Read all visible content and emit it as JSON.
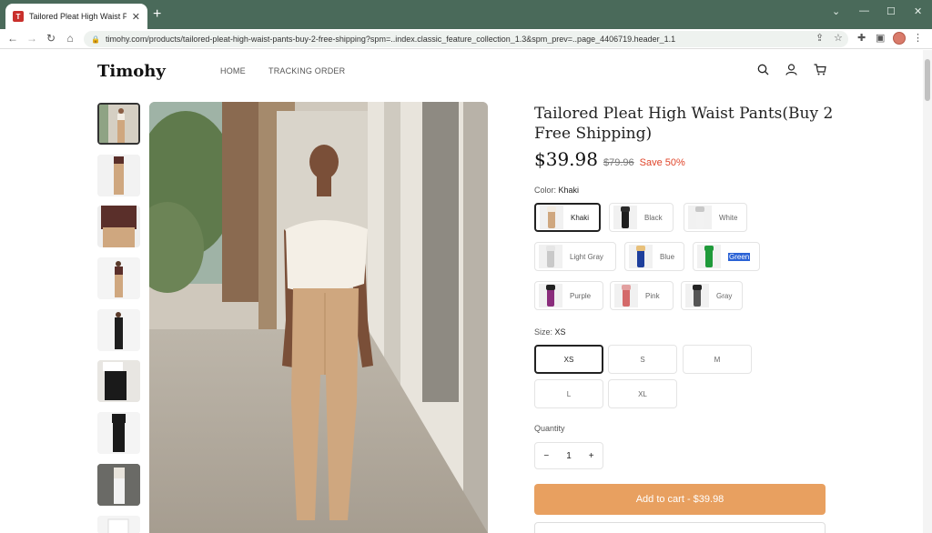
{
  "browser": {
    "tab_title": "Tailored Pleat High Waist Pants(B",
    "url": "timohy.com/products/tailored-pleat-high-waist-pants-buy-2-free-shipping?spm=..index.classic_feature_collection_1.3&spm_prev=..page_4406719.header_1.1",
    "colors": {
      "frame": "#4a6a5a",
      "accent": "#e8a060"
    }
  },
  "site": {
    "logo": "Timohy",
    "nav": [
      "HOME",
      "TRACKING ORDER"
    ]
  },
  "product": {
    "title": "Tailored Pleat High Waist Pants(Buy 2 Free Shipping)",
    "price": "$39.98",
    "old_price": "$79.96",
    "save": "Save 50%",
    "color_label": "Color:",
    "color_value": "Khaki",
    "colors": [
      {
        "label": "Khaki",
        "pants": "#cfa77f",
        "top": "#f3ece2"
      },
      {
        "label": "Black",
        "pants": "#1e1e1e",
        "top": "#2c2c2c"
      },
      {
        "label": "White",
        "pants": "#f2f2f2",
        "top": "#c8c8c8"
      },
      {
        "label": "Light Gray",
        "pants": "#c9c9c9",
        "top": "#e6e6e6"
      },
      {
        "label": "Blue",
        "pants": "#1e3f9c",
        "top": "#e8c07a"
      },
      {
        "label": "Green",
        "pants": "#1f9a3a",
        "top": "#1f9a3a"
      },
      {
        "label": "Purple",
        "pants": "#8a2d7c",
        "top": "#222"
      },
      {
        "label": "Pink",
        "pants": "#d46a6a",
        "top": "#e2a0a0"
      },
      {
        "label": "Gray",
        "pants": "#555",
        "top": "#222"
      }
    ],
    "size_label": "Size:",
    "size_value": "XS",
    "sizes": [
      "XS",
      "S",
      "M",
      "L",
      "XL"
    ],
    "quantity_label": "Quantity",
    "quantity": "1",
    "add_to_cart": "Add to cart - $39.98"
  }
}
